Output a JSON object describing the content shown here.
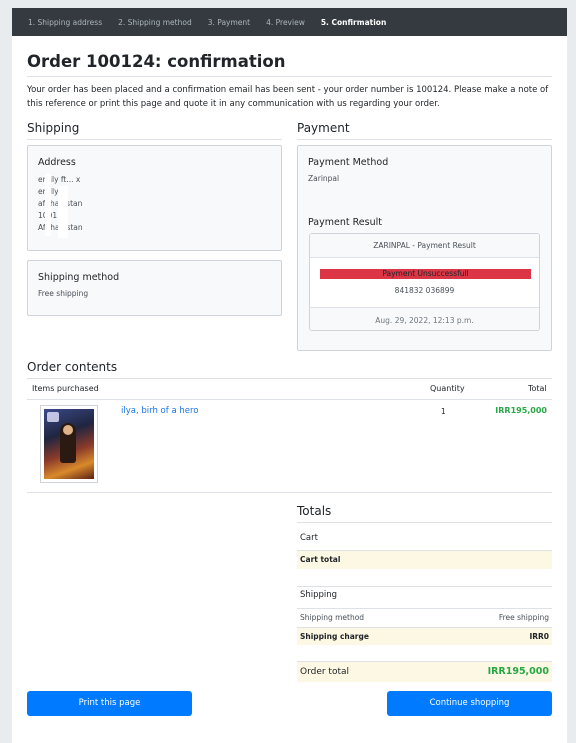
{
  "steps": [
    {
      "label": "1. Shipping address"
    },
    {
      "label": "2. Shipping method"
    },
    {
      "label": "3. Payment"
    },
    {
      "label": "4. Preview"
    },
    {
      "label": "5. Confirmation"
    }
  ],
  "page_title": "Order 100124: confirmation",
  "intro": "Your order has been placed and a confirmation email has been sent - your order number is 100124. Please make a note of this reference or print this page and quote it in any communication with us regarding your order.",
  "shipping": {
    "heading": "Shipping",
    "address_title": "Address",
    "address_lines": [
      "emily ft... x",
      "emily",
      "afghanistan",
      "1001",
      "Afghanistan"
    ],
    "method_title": "Shipping method",
    "method_value": "Free shipping"
  },
  "payment": {
    "heading": "Payment",
    "method_title": "Payment Method",
    "method_value": "Zarinpal",
    "result_title": "Payment Result",
    "result_card": {
      "header": "ZARINPAL - Payment Result",
      "alert": "Payment Unsuccessfull",
      "reference": "841832 036899",
      "date": "Aug. 29, 2022, 12:13 p.m."
    }
  },
  "order_contents": {
    "heading": "Order contents",
    "columns": {
      "items": "Items purchased",
      "quantity": "Quantity",
      "total": "Total"
    },
    "items": [
      {
        "name": "ilya, birh of a hero",
        "quantity": "1",
        "total": "IRR195,000"
      }
    ]
  },
  "totals": {
    "heading": "Totals",
    "cart_heading": "Cart",
    "cart_total_label": "Cart total",
    "shipping_heading": "Shipping",
    "shipping_method_label": "Shipping method",
    "shipping_method_value": "Free shipping",
    "shipping_charge_label": "Shipping charge",
    "shipping_charge_value": "IRR0",
    "order_total_label": "Order total",
    "order_total_value": "IRR195,000"
  },
  "buttons": {
    "print": "Print this page",
    "continue": "Continue shopping"
  },
  "colors": {
    "primary": "#007bff",
    "success": "#28a745",
    "danger": "#dc3545",
    "stepbar": "#343a40",
    "highlight": "#fcf8e3"
  }
}
